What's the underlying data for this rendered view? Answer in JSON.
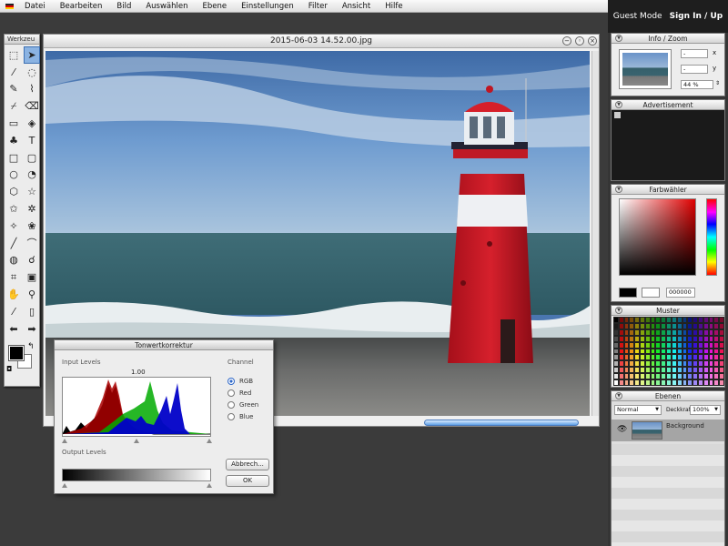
{
  "menu": [
    "Datei",
    "Bearbeiten",
    "Bild",
    "Auswählen",
    "Ebene",
    "Einstellungen",
    "Filter",
    "Ansicht",
    "Hilfe"
  ],
  "account": {
    "guest": "Guest Mode",
    "sign": "Sign In / Up"
  },
  "toolbox": {
    "title": "Werkzeu",
    "tools": [
      {
        "icon": "marquee-icon",
        "glyph": "⬚"
      },
      {
        "icon": "move-icon",
        "glyph": "➤"
      },
      {
        "icon": "magic-wand-icon",
        "glyph": "⁄"
      },
      {
        "icon": "lasso-icon",
        "glyph": "◌"
      },
      {
        "icon": "pencil-icon",
        "glyph": "✎"
      },
      {
        "icon": "brush-icon",
        "glyph": "⌇"
      },
      {
        "icon": "clone-icon",
        "glyph": "⌿"
      },
      {
        "icon": "eraser-icon",
        "glyph": "⌫"
      },
      {
        "icon": "gradient-icon",
        "glyph": "▭"
      },
      {
        "icon": "bucket-icon",
        "glyph": "◈"
      },
      {
        "icon": "stamp-icon",
        "glyph": "♣"
      },
      {
        "icon": "text-icon",
        "glyph": "T"
      },
      {
        "icon": "rectangle-icon",
        "glyph": "□"
      },
      {
        "icon": "rounded-rect-icon",
        "glyph": "▢"
      },
      {
        "icon": "ellipse-icon",
        "glyph": "○"
      },
      {
        "icon": "shape-icon",
        "glyph": "◔"
      },
      {
        "icon": "polygon-icon",
        "glyph": "⬡"
      },
      {
        "icon": "star-icon",
        "glyph": "☆"
      },
      {
        "icon": "star-outline-icon",
        "glyph": "✩"
      },
      {
        "icon": "sparkle-icon",
        "glyph": "✲"
      },
      {
        "icon": "custom-shape-icon",
        "glyph": "✧"
      },
      {
        "icon": "flower-icon",
        "glyph": "❀"
      },
      {
        "icon": "line-icon",
        "glyph": "╱"
      },
      {
        "icon": "curve-icon",
        "glyph": "⌒"
      },
      {
        "icon": "blur-icon",
        "glyph": "◍"
      },
      {
        "icon": "smudge-icon",
        "glyph": "☌"
      },
      {
        "icon": "crop-icon",
        "glyph": "⌗"
      },
      {
        "icon": "resize-icon",
        "glyph": "▣"
      },
      {
        "icon": "hand-icon",
        "glyph": "✋"
      },
      {
        "icon": "zoom-icon",
        "glyph": "⚲"
      },
      {
        "icon": "eyedropper-icon",
        "glyph": "⁄"
      },
      {
        "icon": "trash-icon",
        "glyph": "▯"
      },
      {
        "icon": "arrow-left-icon",
        "glyph": "⬅"
      },
      {
        "icon": "arrow-right-icon",
        "glyph": "➡"
      }
    ],
    "fg_color": "#000000",
    "bg_color": "#ffffff"
  },
  "image_window": {
    "title": "2015-06-03 14.52.00.jpg"
  },
  "levels": {
    "title": "Tonwertkorrektur",
    "input_label": "Input Levels",
    "gamma": "1.00",
    "output_label": "Output Levels",
    "channel_label": "Channel",
    "channels": [
      "RGB",
      "Red",
      "Green",
      "Blue"
    ],
    "selected_channel": "RGB",
    "cancel": "Abbrech...",
    "ok": "OK"
  },
  "info": {
    "title": "Info / Zoom",
    "x_value": "-",
    "x_label": "x",
    "y_value": "-",
    "y_label": "y",
    "zoom": "44 %"
  },
  "advertisement": {
    "title": "Advertisement"
  },
  "colorpicker": {
    "title": "Farbwähler",
    "hex": "000000",
    "fg": "#000000",
    "bg": "#ffffff"
  },
  "pattern": {
    "title": "Muster"
  },
  "layers": {
    "title": "Ebenen",
    "blend_mode": "Normal",
    "opacity_label": "Deckkraft:",
    "opacity": "100%",
    "items": [
      {
        "name": "Background"
      }
    ]
  }
}
